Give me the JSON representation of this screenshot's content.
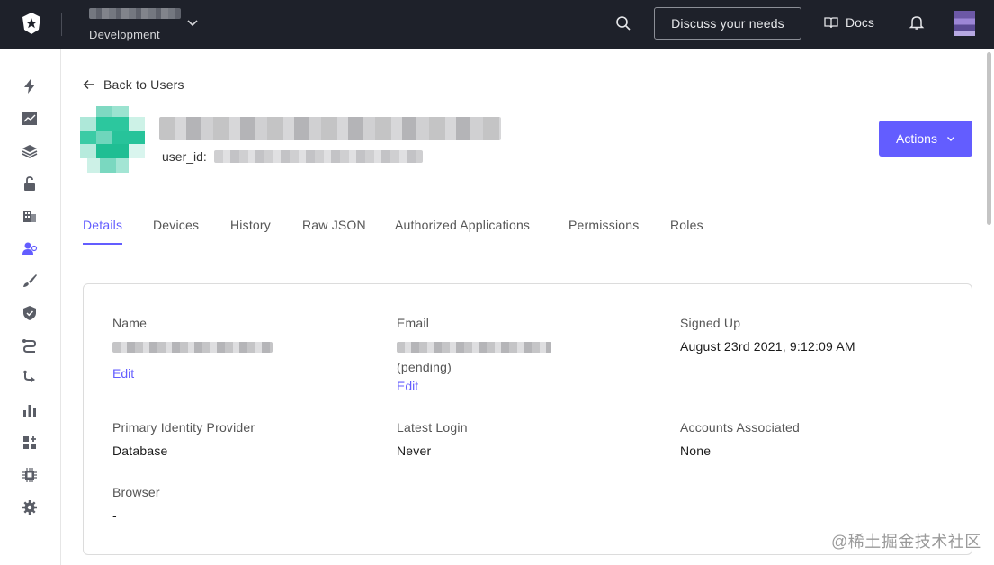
{
  "topbar": {
    "environment": "Development",
    "discuss_label": "Discuss your needs",
    "docs_label": "Docs"
  },
  "sidebar": {
    "items": [
      "lightning-icon",
      "activity-icon",
      "applications-icon",
      "authentication-icon",
      "organizations-icon",
      "user-management-icon",
      "branding-icon",
      "security-icon",
      "actions-icon",
      "auth-pipeline-icon",
      "monitoring-icon",
      "marketplace-icon",
      "extensions-icon",
      "settings-icon"
    ]
  },
  "page": {
    "back_label": "Back to Users",
    "user_id_label": "user_id:",
    "actions_label": "Actions"
  },
  "tabs": [
    {
      "label": "Details",
      "active": true
    },
    {
      "label": "Devices"
    },
    {
      "label": "History"
    },
    {
      "label": "Raw JSON"
    },
    {
      "label": "Authorized Applications"
    },
    {
      "label": "Permissions"
    },
    {
      "label": "Roles"
    }
  ],
  "details": {
    "name_label": "Name",
    "name_edit": "Edit",
    "email_label": "Email",
    "email_status": "(pending)",
    "email_edit": "Edit",
    "signed_up_label": "Signed Up",
    "signed_up_value": "August 23rd 2021, 9:12:09 AM",
    "primary_idp_label": "Primary Identity Provider",
    "primary_idp_value": "Database",
    "latest_login_label": "Latest Login",
    "latest_login_value": "Never",
    "accounts_label": "Accounts Associated",
    "accounts_value": "None",
    "browser_label": "Browser",
    "browser_value": "-"
  },
  "watermark": "@稀土掘金技术社区",
  "colors": {
    "accent": "#635dff",
    "topbar_bg": "#1e212a"
  }
}
